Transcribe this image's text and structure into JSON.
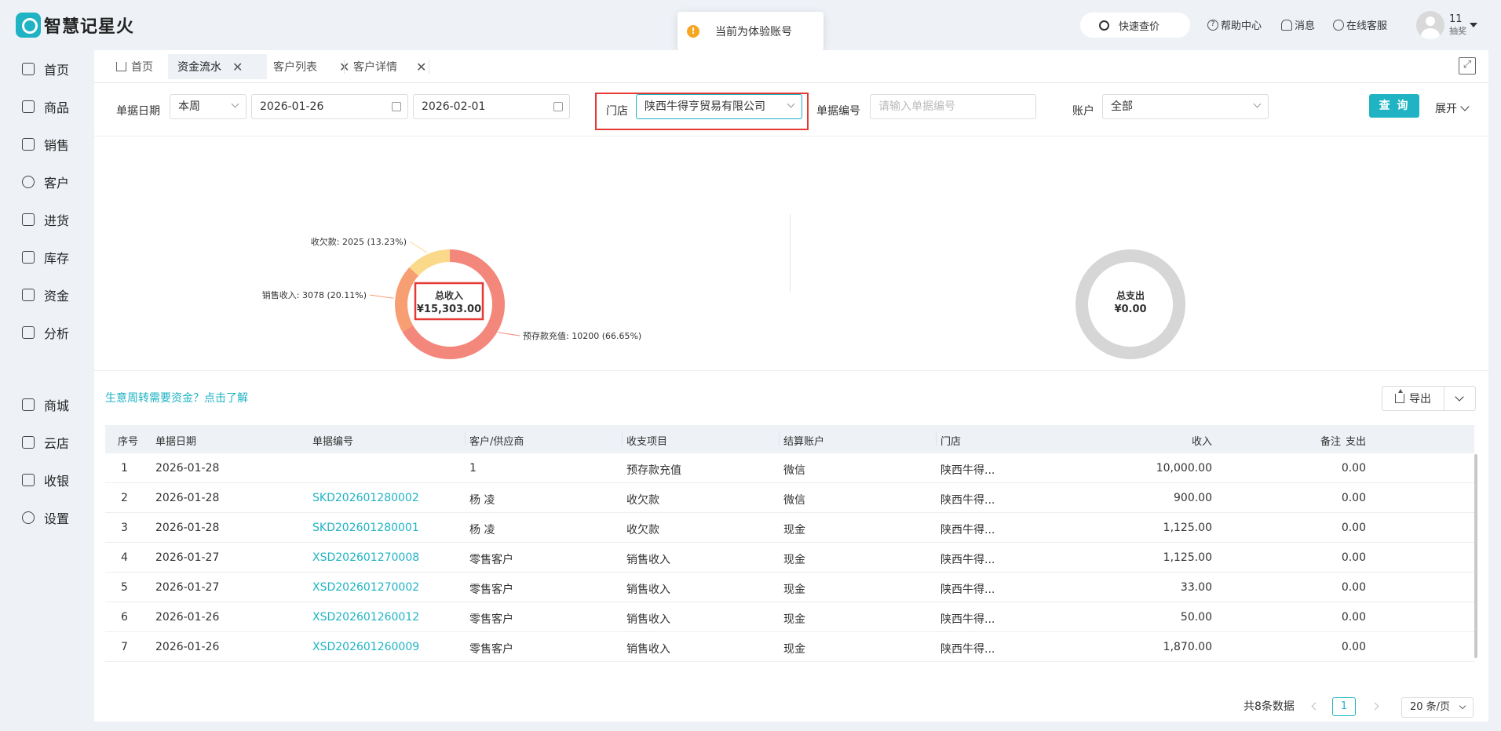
{
  "app": {
    "title": "智慧记星火"
  },
  "toast": {
    "text": "当前为体验账号"
  },
  "header": {
    "quick_search": "快速查价",
    "help": "帮助中心",
    "messages": "消息",
    "support": "在线客服",
    "user_name": "11",
    "user_role": "抽奖"
  },
  "sidebar": {
    "items": [
      {
        "label": "首页",
        "icon": "home-icon"
      },
      {
        "label": "商品",
        "icon": "bag-icon"
      },
      {
        "label": "销售",
        "icon": "clipboard-icon"
      },
      {
        "label": "客户",
        "icon": "user-icon"
      },
      {
        "label": "进货",
        "icon": "book-icon"
      },
      {
        "label": "库存",
        "icon": "warehouse-icon"
      },
      {
        "label": "资金",
        "icon": "wallet-icon"
      },
      {
        "label": "分析",
        "icon": "chart-icon"
      },
      {
        "label": "商城",
        "icon": "store-icon"
      },
      {
        "label": "云店",
        "icon": "shop-icon"
      },
      {
        "label": "收银",
        "icon": "cashier-icon"
      },
      {
        "label": "设置",
        "icon": "gear-icon"
      }
    ]
  },
  "tabs": [
    {
      "label": "首页"
    },
    {
      "label": "资金流水"
    },
    {
      "label": "客户列表"
    },
    {
      "label": "客户详情"
    }
  ],
  "filter": {
    "date_label": "单据日期",
    "period": "本周",
    "start_date": "2026-01-26",
    "end_date": "2026-02-01",
    "store_label": "门店",
    "store_value": "陕西牛得亨贸易有限公司",
    "doc_label": "单据编号",
    "doc_placeholder": "请输入单据编号",
    "account_label": "账户",
    "account_value": "全部",
    "query": "查 询",
    "expand": "展开"
  },
  "chart_data": [
    {
      "type": "pie",
      "center_title": "总收入",
      "center_value": "¥15,303.00",
      "slices": [
        {
          "label": "预存款充值",
          "value": 10200,
          "percent": "66.65%",
          "color": "#f4877c"
        },
        {
          "label": "销售收入",
          "value": 3078,
          "percent": "20.11%",
          "color": "#f79e72"
        },
        {
          "label": "收欠款",
          "value": 2025,
          "percent": "13.23%",
          "color": "#fbd98a"
        }
      ]
    },
    {
      "type": "pie",
      "center_title": "总支出",
      "center_value": "¥0.00",
      "slices": [],
      "color": "#d6d6d6"
    }
  ],
  "promo": "生意周转需要资金？点击了解",
  "export": "导出",
  "table": {
    "headers": [
      "序号",
      "单据日期",
      "单据编号",
      "客户/供应商",
      "收支项目",
      "结算账户",
      "门店",
      "收入",
      "支出",
      "备注"
    ],
    "rows": [
      {
        "no": "1",
        "date": "2026-01-28",
        "doc": "",
        "party": "1",
        "item": "预存款充值",
        "account": "微信",
        "store": "陕西牛得...",
        "income": "10,000.00",
        "expense": "0.00"
      },
      {
        "no": "2",
        "date": "2026-01-28",
        "doc": "SKD202601280002",
        "party": "杨 凌",
        "item": "收欠款",
        "account": "微信",
        "store": "陕西牛得...",
        "income": "900.00",
        "expense": "0.00"
      },
      {
        "no": "3",
        "date": "2026-01-28",
        "doc": "SKD202601280001",
        "party": "杨 凌",
        "item": "收欠款",
        "account": "现金",
        "store": "陕西牛得...",
        "income": "1,125.00",
        "expense": "0.00"
      },
      {
        "no": "4",
        "date": "2026-01-27",
        "doc": "XSD202601270008",
        "party": "零售客户",
        "item": "销售收入",
        "account": "现金",
        "store": "陕西牛得...",
        "income": "1,125.00",
        "expense": "0.00"
      },
      {
        "no": "5",
        "date": "2026-01-27",
        "doc": "XSD202601270002",
        "party": "零售客户",
        "item": "销售收入",
        "account": "现金",
        "store": "陕西牛得...",
        "income": "33.00",
        "expense": "0.00"
      },
      {
        "no": "6",
        "date": "2026-01-26",
        "doc": "XSD202601260012",
        "party": "零售客户",
        "item": "销售收入",
        "account": "现金",
        "store": "陕西牛得...",
        "income": "50.00",
        "expense": "0.00"
      },
      {
        "no": "7",
        "date": "2026-01-26",
        "doc": "XSD202601260009",
        "party": "零售客户",
        "item": "销售收入",
        "account": "现金",
        "store": "陕西牛得...",
        "income": "1,870.00",
        "expense": "0.00"
      }
    ]
  },
  "pagination": {
    "total": "共8条数据",
    "current": "1",
    "page_size": "20 条/页"
  }
}
